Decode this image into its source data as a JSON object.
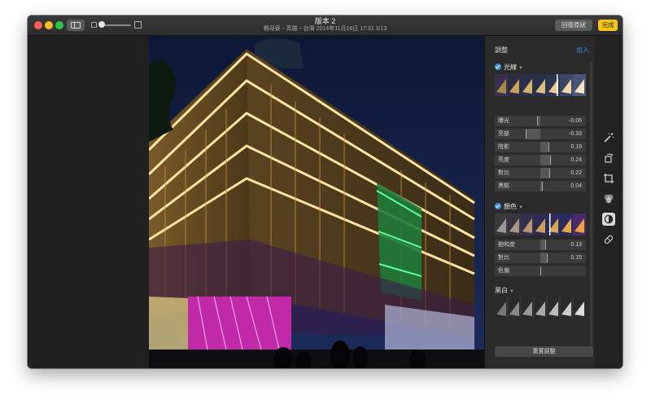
{
  "window": {
    "title": "版本 2",
    "subtitle": "鴨母寮・高雄・台灣  2014年11月16日 17:31    3/13",
    "revert_label": "回復原狀",
    "done_label": "完成"
  },
  "panel": {
    "title": "調整",
    "add_label": "加入",
    "light": {
      "label": "光線",
      "rows": [
        {
          "label": "曝光",
          "value": "-0.06",
          "level": -0.06
        },
        {
          "label": "亮部",
          "value": "-0.33",
          "level": -0.33
        },
        {
          "label": "陰影",
          "value": "0.19",
          "level": 0.19
        },
        {
          "label": "亮度",
          "value": "0.24",
          "level": 0.24
        },
        {
          "label": "對比",
          "value": "0.22",
          "level": 0.22
        },
        {
          "label": "黑點",
          "value": "0.04",
          "level": 0.04
        }
      ]
    },
    "color": {
      "label": "顏色",
      "rows": [
        {
          "label": "飽和度",
          "value": "0.13",
          "level": 0.13
        },
        {
          "label": "對比",
          "value": "0.15",
          "level": 0.15
        },
        {
          "label": "色偏",
          "value": "",
          "level": 0
        }
      ]
    },
    "bw": {
      "label": "黑白"
    },
    "reset_label": "重置調整"
  },
  "tools": [
    "magic-wand-icon",
    "rotate-icon",
    "crop-icon",
    "filters-icon",
    "adjust-icon",
    "retouch-icon"
  ],
  "colors": {
    "accent": "#3a8ee8",
    "done": "#f5c518"
  }
}
